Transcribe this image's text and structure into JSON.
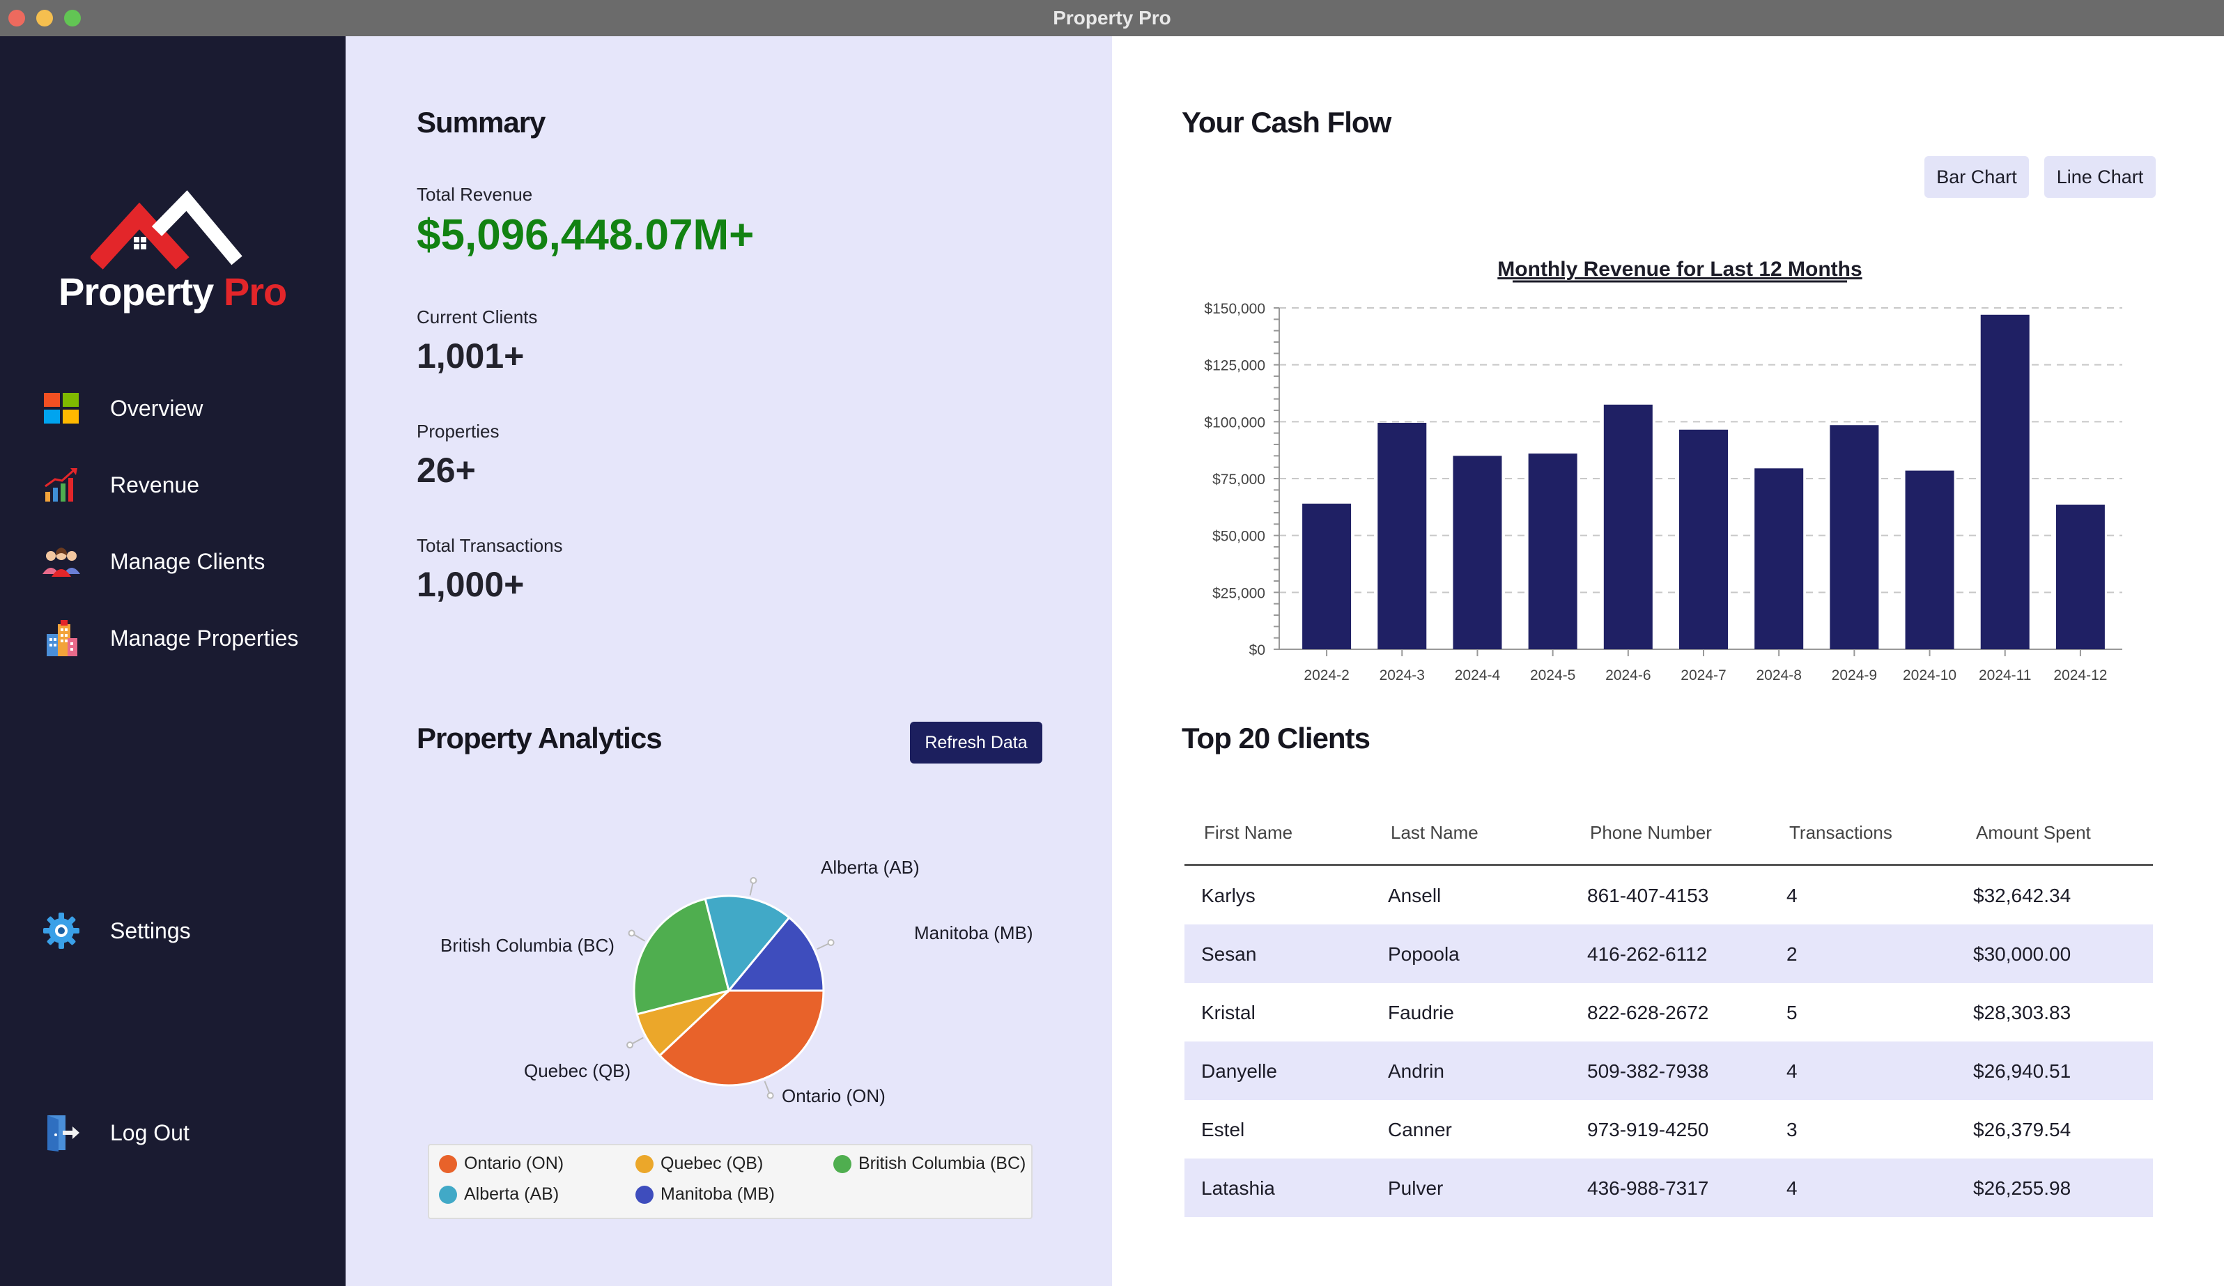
{
  "window": {
    "title": "Property Pro"
  },
  "brand": {
    "name_part1": "Property",
    "name_part2": "Pro",
    "primary_color": "#1a1b31",
    "accent_color": "#e3262a"
  },
  "sidebar": {
    "items": [
      {
        "label": "Overview",
        "icon": "windows-tiles-icon"
      },
      {
        "label": "Revenue",
        "icon": "growth-chart-icon"
      },
      {
        "label": "Manage Clients",
        "icon": "people-icon"
      },
      {
        "label": "Manage Properties",
        "icon": "buildings-icon"
      }
    ],
    "settings": {
      "label": "Settings",
      "icon": "gear-icon"
    },
    "logout": {
      "label": "Log Out",
      "icon": "logout-door-icon"
    }
  },
  "summary": {
    "title": "Summary",
    "stats": [
      {
        "label": "Total Revenue",
        "value": "$5,096,448.07M+"
      },
      {
        "label": "Current Clients",
        "value": "1,001+"
      },
      {
        "label": "Properties",
        "value": "26+"
      },
      {
        "label": "Total Transactions",
        "value": "1,000+"
      }
    ]
  },
  "analytics": {
    "title": "Property Analytics",
    "refresh_label": "Refresh Data"
  },
  "cashflow": {
    "title": "Your Cash Flow",
    "bar_button": "Bar Chart",
    "line_button": "Line Chart"
  },
  "chart_data": [
    {
      "type": "bar",
      "title": "Monthly Revenue for Last 12 Months",
      "categories": [
        "2024-2",
        "2024-3",
        "2024-4",
        "2024-5",
        "2024-6",
        "2024-7",
        "2024-8",
        "2024-9",
        "2024-10",
        "2024-11",
        "2024-12"
      ],
      "values": [
        64000,
        99500,
        85000,
        86000,
        107500,
        96500,
        79500,
        98500,
        78500,
        147000,
        63500
      ],
      "ylim": [
        0,
        150000
      ],
      "yticks": [
        "$0",
        "$25,000",
        "$50,000",
        "$75,000",
        "$100,000",
        "$125,000",
        "$150,000"
      ],
      "grid": true,
      "bar_color": "#1f2064"
    },
    {
      "type": "pie",
      "labels": [
        "Ontario (ON)",
        "Quebec (QB)",
        "British Columbia (BC)",
        "Alberta (AB)",
        "Manitoba (MB)"
      ],
      "values": [
        38,
        8,
        25,
        15,
        14
      ],
      "colors": [
        "#e8622a",
        "#eba72a",
        "#4fae4f",
        "#41a9c7",
        "#3e4dbd"
      ],
      "legend_position": "bottom"
    }
  ],
  "clients": {
    "title": "Top 20 Clients",
    "columns": [
      "First Name",
      "Last Name",
      "Phone Number",
      "Transactions",
      "Amount Spent"
    ],
    "rows": [
      [
        "Karlys",
        "Ansell",
        "861-407-4153",
        "4",
        "$32,642.34"
      ],
      [
        "Sesan",
        "Popoola",
        "416-262-6112",
        "2",
        "$30,000.00"
      ],
      [
        "Kristal",
        "Faudrie",
        "822-628-2672",
        "5",
        "$28,303.83"
      ],
      [
        "Danyelle",
        "Andrin",
        "509-382-7938",
        "4",
        "$26,940.51"
      ],
      [
        "Estel",
        "Canner",
        "973-919-4250",
        "3",
        "$26,379.54"
      ],
      [
        "Latashia",
        "Pulver",
        "436-988-7317",
        "4",
        "$26,255.98"
      ]
    ]
  }
}
